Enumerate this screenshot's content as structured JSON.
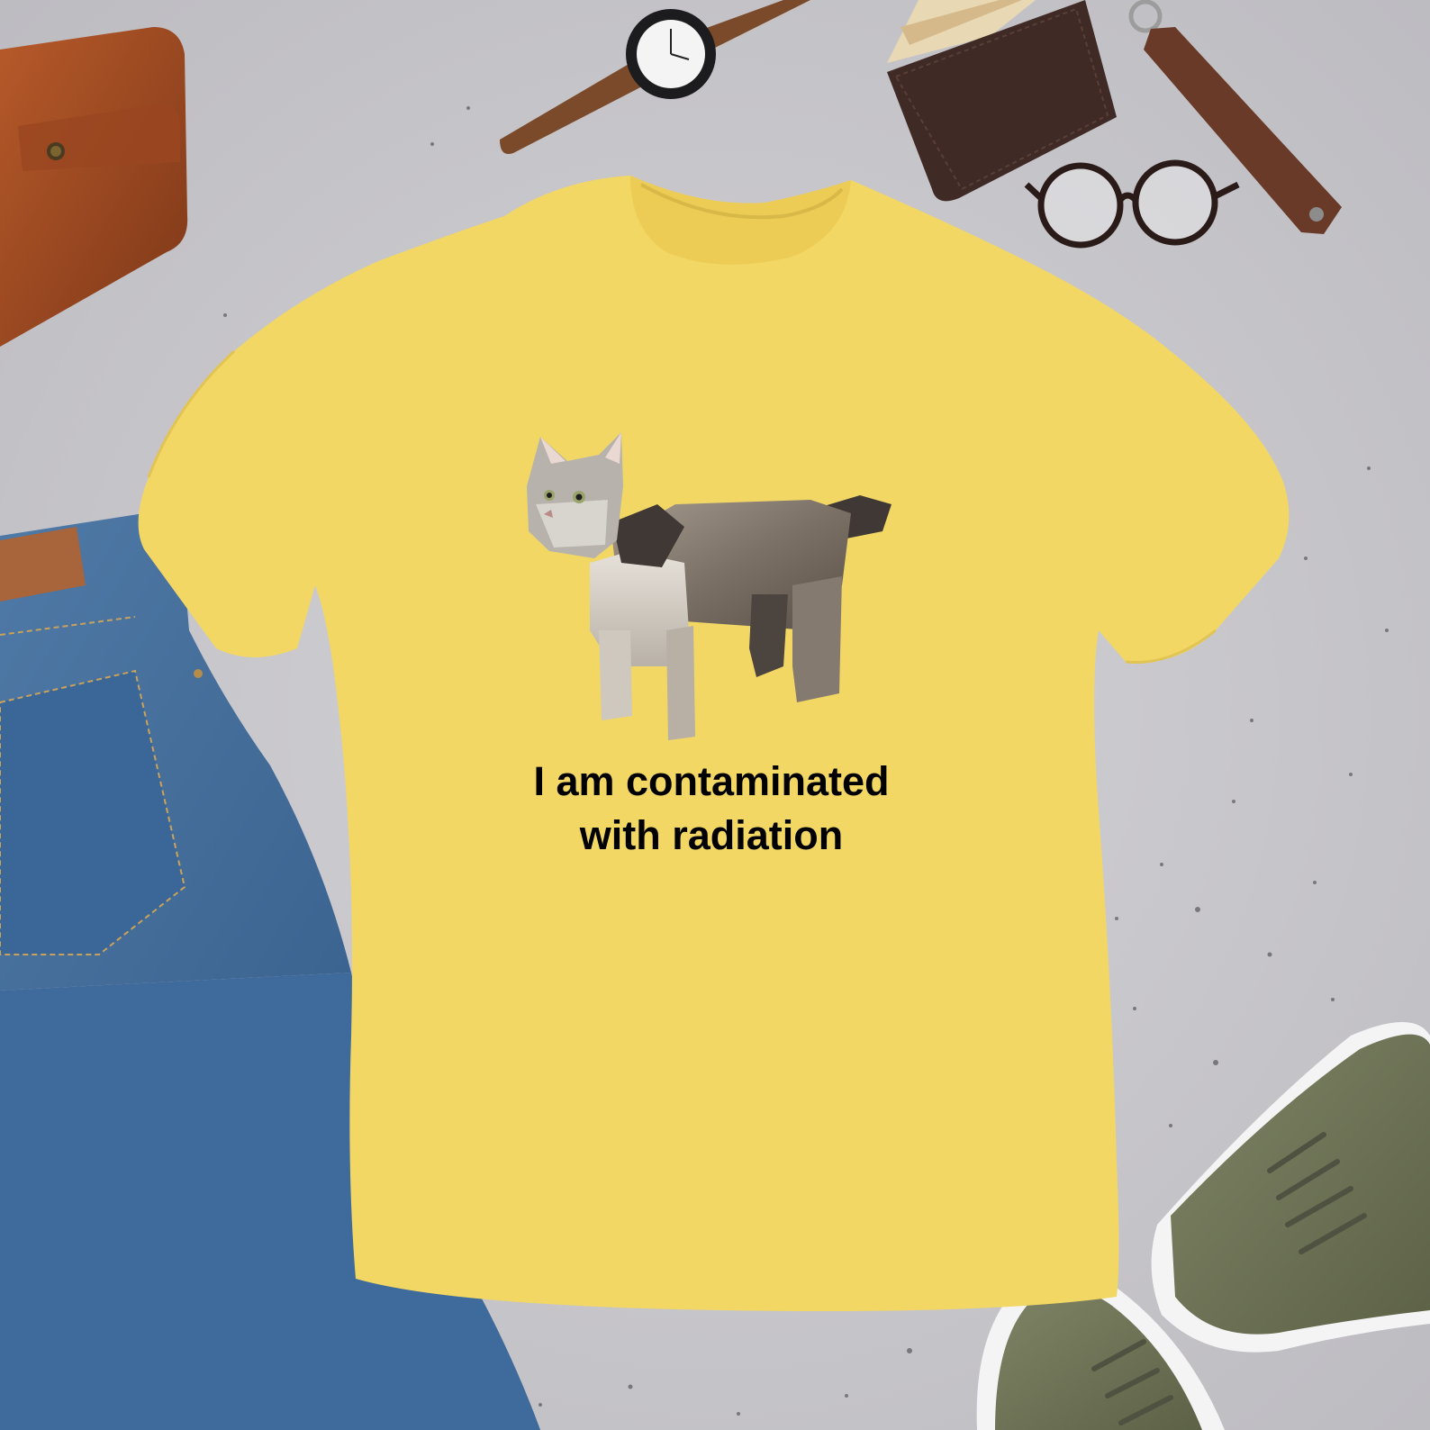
{
  "shirt": {
    "caption_line_1": "I am contaminated",
    "caption_line_2": "with radiation",
    "color": "#f2d765"
  },
  "background_color": "#c9c8cc",
  "items": [
    "leather-notebook",
    "wrist-watch",
    "wallet-with-cash",
    "leather-strap",
    "eyeglasses",
    "blue-jeans",
    "green-sneakers"
  ]
}
